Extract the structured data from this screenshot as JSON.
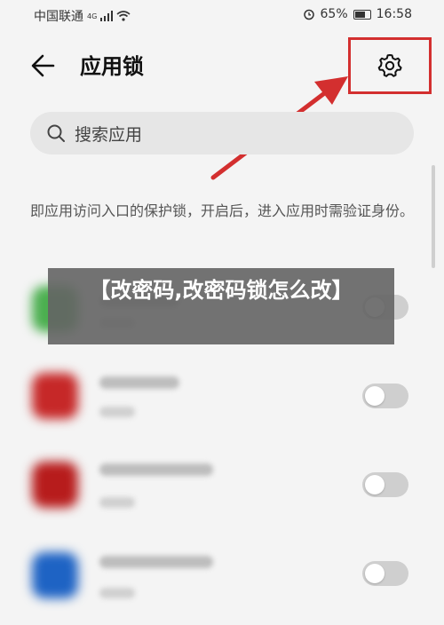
{
  "status_bar": {
    "carrier": "中国联通",
    "network": "4G",
    "battery": "65%",
    "time": "16:58",
    "icons": [
      "signal-icon",
      "wifi-icon",
      "alarm-icon",
      "battery-icon"
    ]
  },
  "header": {
    "title": "应用锁",
    "back_icon": "back-arrow-icon",
    "settings_icon": "gear-icon"
  },
  "search": {
    "placeholder": "搜索应用",
    "icon": "search-icon"
  },
  "description": "即应用访问入口的保护锁，开启后，进入应用时需验证身份。",
  "overlay": {
    "text": "【改密码,改密码锁怎么改】"
  },
  "apps": [
    {
      "name": "",
      "enabled": false,
      "icon_color": "#4caf50"
    },
    {
      "name": "",
      "enabled": false,
      "icon_color": "#c62828"
    },
    {
      "name": "",
      "enabled": false,
      "icon_color": "#b71c1c"
    },
    {
      "name": "",
      "enabled": false,
      "icon_color": "#1e63c4"
    }
  ],
  "annotation_color": "#d32f2f"
}
